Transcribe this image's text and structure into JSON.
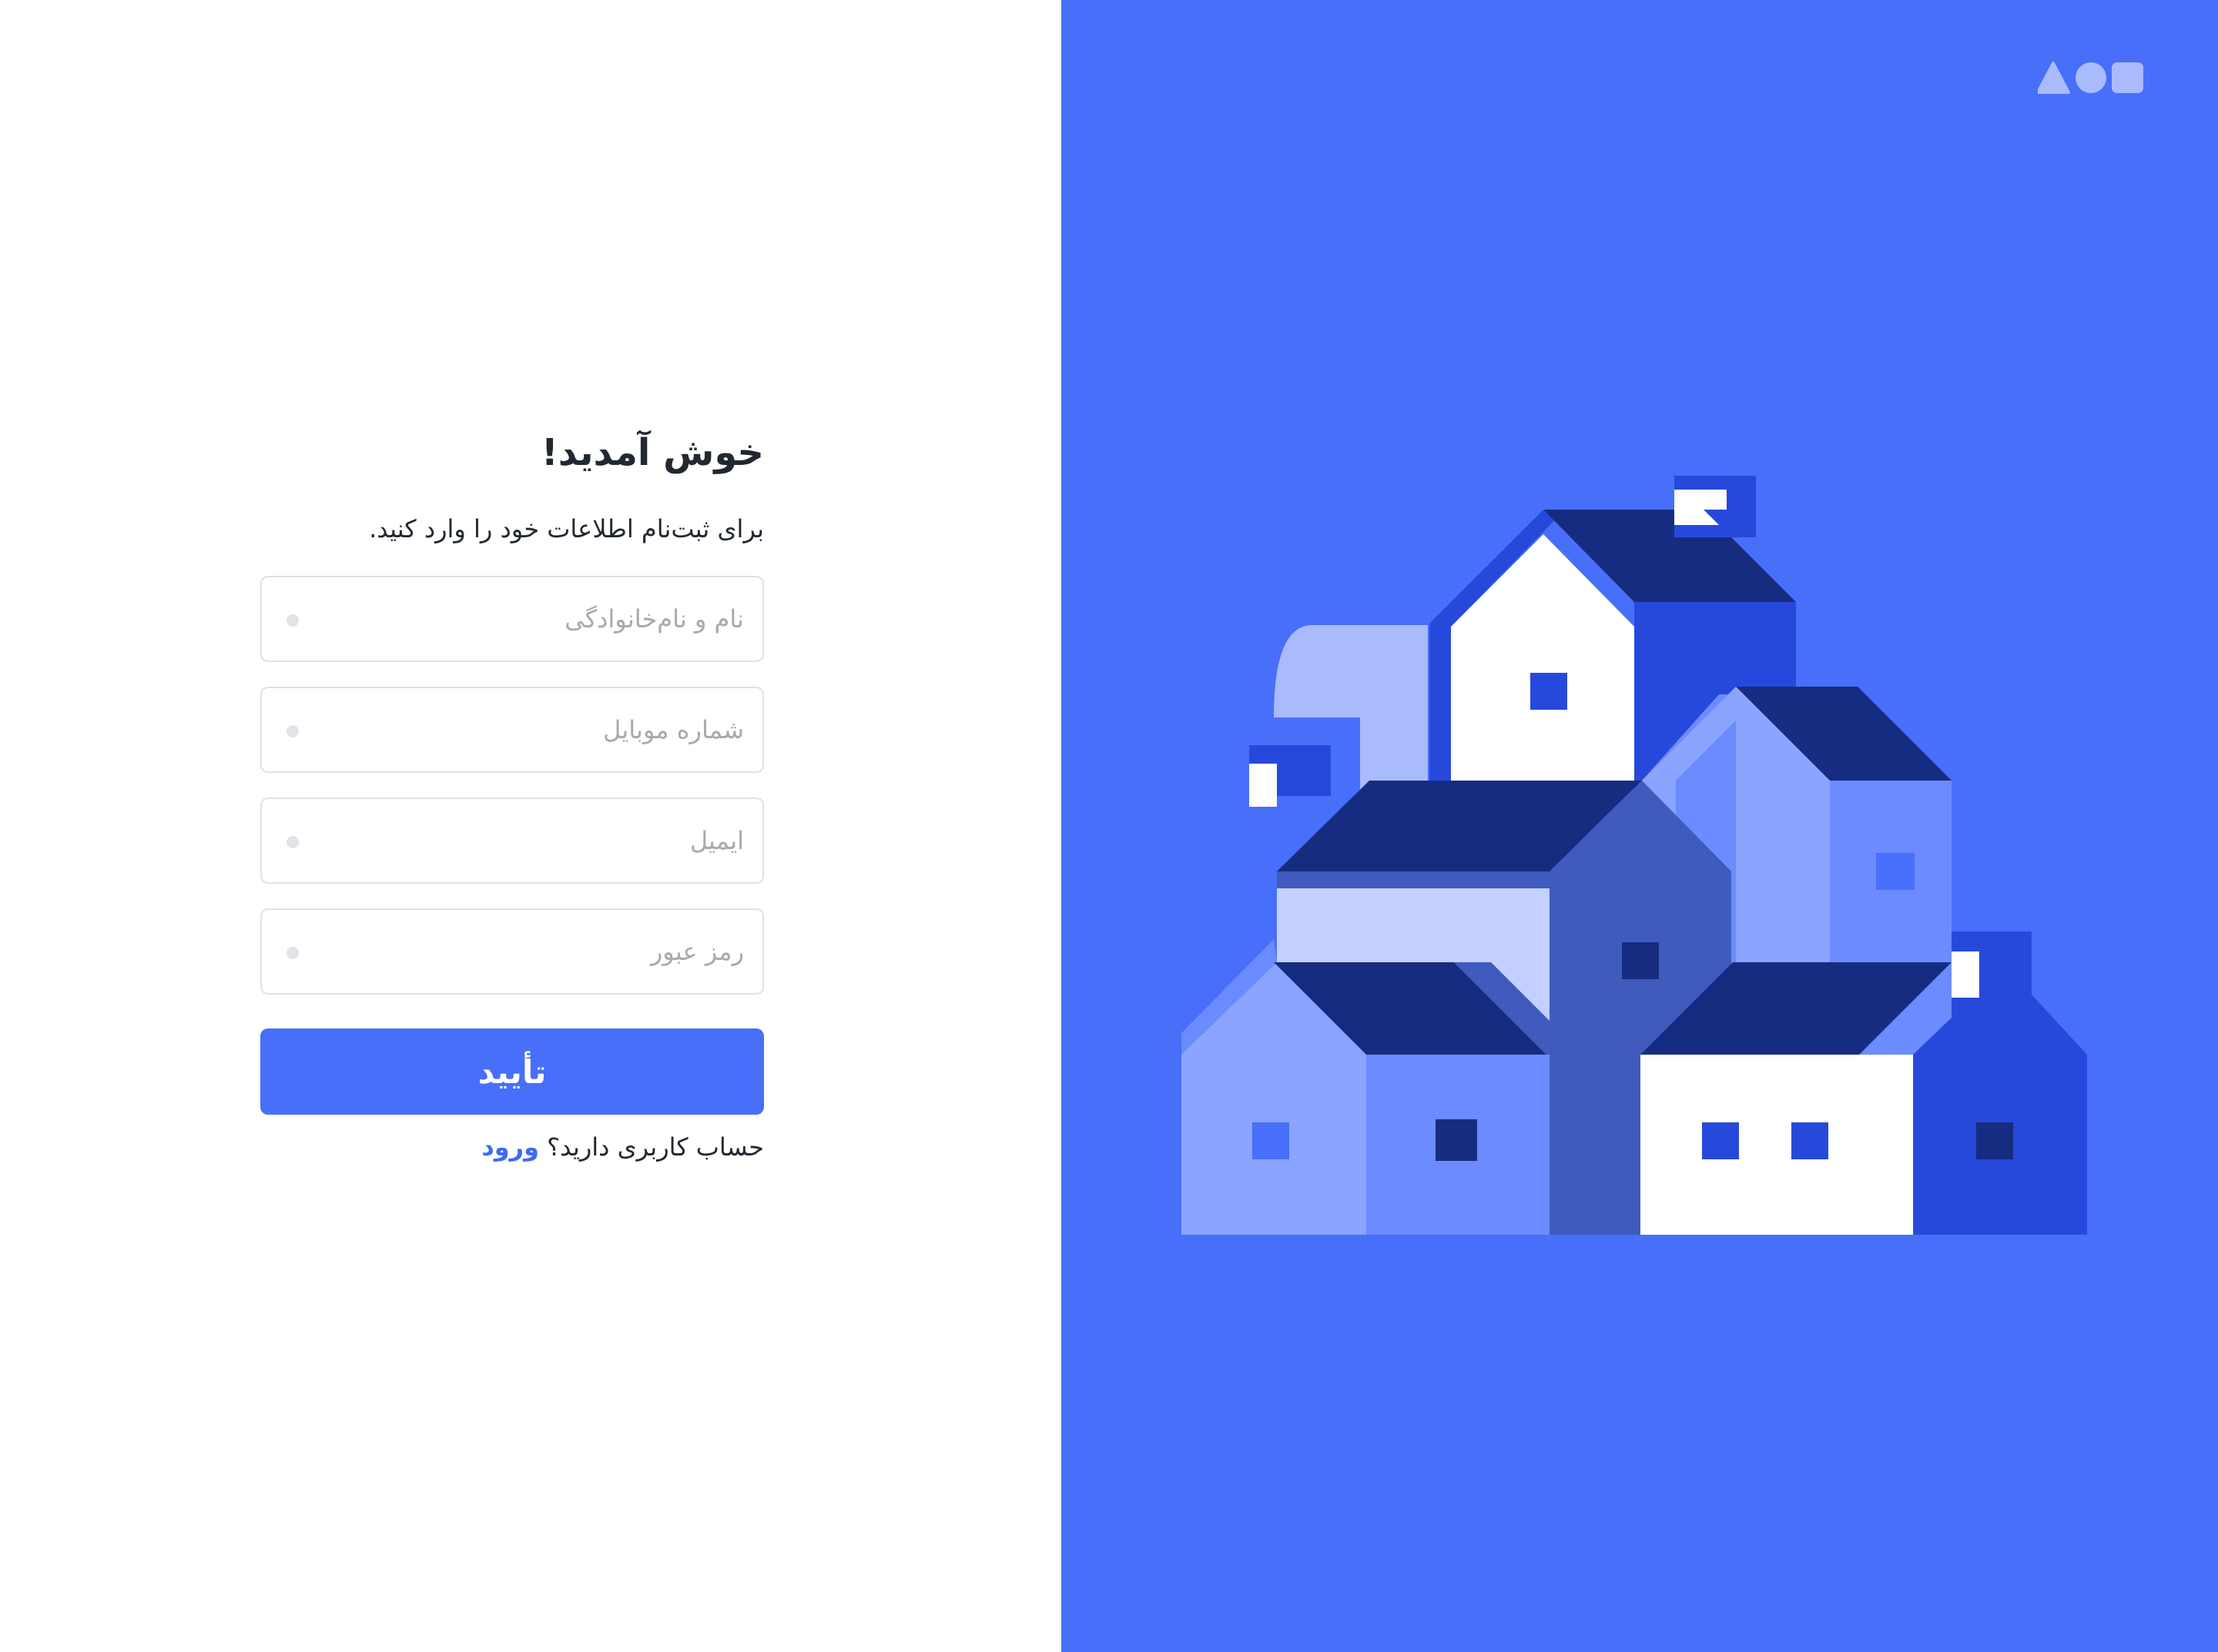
{
  "form": {
    "title": "خوش آمدید!",
    "subtitle": "برای ثبت‌نام اطلاعات خود را وارد کنید.",
    "fields": [
      {
        "placeholder": "نام و نام‌خانوادگی",
        "value": ""
      },
      {
        "placeholder": "شماره موبایل",
        "value": ""
      },
      {
        "placeholder": "ایمیل",
        "value": ""
      },
      {
        "placeholder": "رمز عبور",
        "value": ""
      }
    ],
    "submit_label": "تأیید",
    "login_prompt": "حساب کاربری دارید؟",
    "login_link": "ورود"
  },
  "brand": {
    "logo_icon": "shapes-logo-icon"
  },
  "illustration": {
    "subject": "houses-illustration"
  },
  "colors": {
    "accent": "#476ff9",
    "illustration_bg": "#476ff9",
    "text": "#222831",
    "placeholder": "#a6a9b0",
    "border": "#dfe1e6",
    "link": "#3f6cf0"
  }
}
